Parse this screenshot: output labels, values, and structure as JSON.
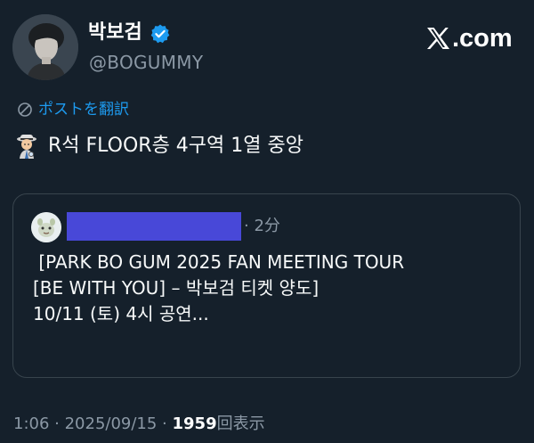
{
  "profile": {
    "display_name": "박보검",
    "handle": "@BOGUMMY",
    "verified_icon": "verified-badge-icon",
    "avatar_icon": "avatar"
  },
  "brand": {
    "text": ".com",
    "logo_icon": "x-logo-icon"
  },
  "translate": {
    "label": "ポストを翻訳",
    "icon": "translate-globe-icon"
  },
  "post": {
    "text": "R석 FLOOR층 4구역 1열 중앙",
    "emoji_icon": "detective-emoji-icon"
  },
  "quote": {
    "time": "· 2分",
    "lines": [
      " [PARK BO GUM 2025 FAN MEETING TOUR",
      "[BE WITH YOU] – 박보검 티켓 양도]",
      "",
      "10/11 (토) 4시 공연..."
    ]
  },
  "meta": {
    "time_date": "1:06 · 2025/09/15 · ",
    "views_count": "1959",
    "views_label": "回表示"
  },
  "colors": {
    "background": "#15202b",
    "accent": "#1d9bf0",
    "redaction": "#4848d8",
    "border": "#38444d"
  }
}
